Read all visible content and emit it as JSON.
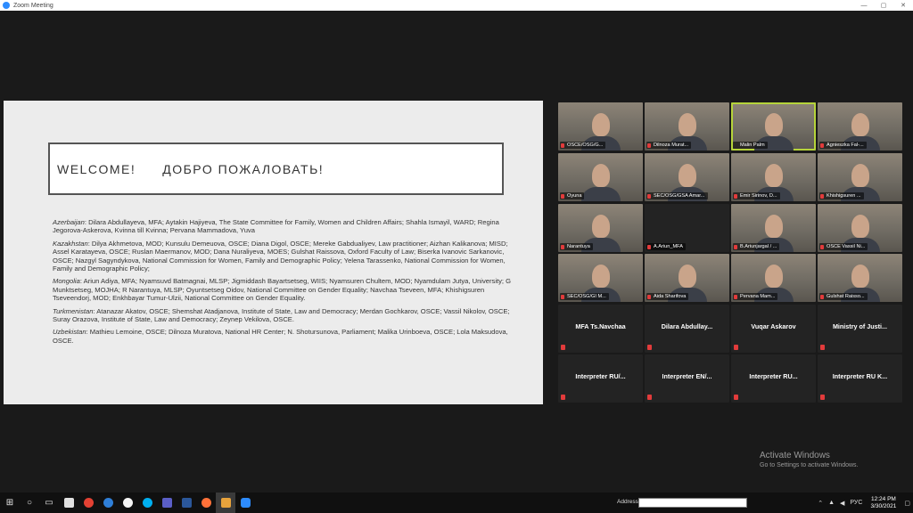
{
  "window": {
    "title": "Zoom Meeting",
    "controls": [
      "—",
      "▢",
      "✕"
    ]
  },
  "slide": {
    "welcome_en": "WELCOME!",
    "welcome_ru": "ДОБРО ПОЖАЛОВАТЬ!",
    "sections": [
      {
        "country": "Azerbaijan",
        "text": ": Dilara Abdullayeva,  MFA; Aytakin Hajiyeva, The State Committee for Family, Women and Children Affairs; Shahla Ismayil, WARD; Regina Jegorova-Askerova, Kvinna till Kvinna; Pervana Mammadova, Yuva"
      },
      {
        "country": "Kazakhstan",
        "text": ": Dilya Akhmetova, MOD; Kunsulu Demeuova, OSCE;  Diana Digol, OSCE; Mereke Gabdualiyev, Law practitioner; Aizhan Kalikanova; MISD; Assel Karatayeva, OSCE; Ruslan Maermanov, MOD; Dana Nuraliyeva, MOES; Gulshat Raissova, Oxford Faculty of Law; Biserka Ivanovic Sarkanovic, OSCE; Nazgyl Sagyndykova, National Commission for Women, Family and Demographic Policy; Yelena Tarassenko, National Commission for Women, Family and Demographic Policy;"
      },
      {
        "country": "Mongolia",
        "text": ": Ariun Adiya, MFA; Nyamsuvd Batmagnai, MLSP; Jigmiddash Bayartsetseg, WIIS; Nyamsuren Chultem, MOD; Nyamdulam Jutya, University; G Munktsetseg, MOJHA; R Narantuya, MLSP; Oyuntsetseg Oidov, National Committee on Gender Equality; Navchaa Tseveen, MFA; Khishigsuren Tseveendorj, MOD; Enkhbayar Tumur-Ulzii, National Committee on Gender Equality."
      },
      {
        "country": "Turkmenistan",
        "text": ": Atanazar Akatov, OSCE; Shemshat Atadjanova, Institute of State, Law and Democracy; Merdan Gochkarov, OSCE; Vassil Nikolov, OSCE; Suray Orazova, Institute of State, Law and Democracy;  Zeynep Vekilova, OSCE."
      },
      {
        "country": "Uzbekistan",
        "text": ": Mathieu Lemoine, OSCE; Dilnoza Muratova, National HR Center; N. Shotursunova, Parliament; Malika Urinboeva, OSCE; Lola Maksudova, OSCE."
      }
    ]
  },
  "participants": [
    {
      "name": "OSCE/OSG/G...",
      "type": "video",
      "muted": true
    },
    {
      "name": "Dilnoza Murat...",
      "type": "video",
      "muted": true
    },
    {
      "name": "Malin Palm",
      "type": "video",
      "muted": false,
      "active": true
    },
    {
      "name": "Agnieszka Fal-...",
      "type": "video",
      "muted": true
    },
    {
      "name": "Oyuna",
      "type": "video",
      "muted": true
    },
    {
      "name": "SEC/OSG/GSA Amar...",
      "type": "video",
      "muted": true
    },
    {
      "name": "Emir Sirinov, D...",
      "type": "video",
      "muted": true
    },
    {
      "name": "Khishigsuren ...",
      "type": "video",
      "muted": true
    },
    {
      "name": "Narantuya",
      "type": "video",
      "muted": true
    },
    {
      "name": "A.Ariun_MFA",
      "type": "dark-video",
      "muted": true
    },
    {
      "name": "B.Ariunjargal / ...",
      "type": "video",
      "muted": true
    },
    {
      "name": "OSCE Vassil Ni...",
      "type": "video",
      "muted": true
    },
    {
      "name": "SEC/OSG/GI M...",
      "type": "video",
      "muted": true
    },
    {
      "name": "Aida Sharifova",
      "type": "video",
      "muted": true
    },
    {
      "name": "Pervana Mam...",
      "type": "video",
      "muted": true
    },
    {
      "name": "Gulshat Raisso...",
      "type": "video",
      "muted": true
    },
    {
      "name": "MFA Ts.Navchaa",
      "type": "name",
      "muted": true
    },
    {
      "name": "Dilara  Abdullay...",
      "type": "name",
      "muted": true
    },
    {
      "name": "Vuqar Askarov",
      "type": "name",
      "muted": true
    },
    {
      "name": "Ministry of Justi...",
      "type": "name",
      "muted": true
    },
    {
      "name": "Interpreter RU/...",
      "type": "name",
      "muted": true
    },
    {
      "name": "Interpreter EN/...",
      "type": "name",
      "muted": true
    },
    {
      "name": "Interpreter RU...",
      "type": "name",
      "muted": true
    },
    {
      "name": "Interpreter RU K...",
      "type": "name",
      "muted": true
    }
  ],
  "watermark": {
    "title": "Activate Windows",
    "subtitle": "Go to Settings to activate Windows."
  },
  "taskbar": {
    "address_label": "Address",
    "language": "РУС",
    "time": "12:24 PM",
    "date": "3/30/2021",
    "icons": [
      "windows-icon",
      "search-icon",
      "task-view-icon",
      "store-icon",
      "chrome-icon",
      "edge-icon",
      "yandex-icon",
      "skype-icon",
      "teams-icon",
      "word-icon",
      "firefox-icon",
      "zoom-active-icon",
      "zoom-icon"
    ]
  },
  "colors": {
    "background": "#1a1a1a",
    "active_speaker": "#b6d43a",
    "mute": "#e23b3b"
  }
}
